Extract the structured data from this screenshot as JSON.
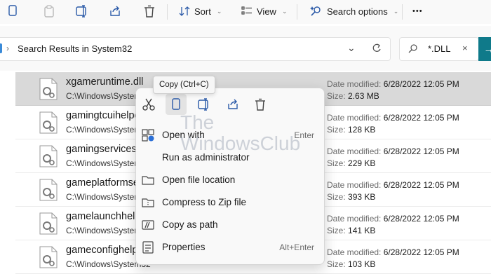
{
  "toolbar": {
    "sort_label": "Sort",
    "view_label": "View",
    "search_options_label": "Search options",
    "more_label": "•••"
  },
  "address": {
    "path_text": "Search Results in System32"
  },
  "search": {
    "value": "*.DLL"
  },
  "files": [
    {
      "name": "xgameruntime.dll",
      "path": "C:\\Windows\\System32",
      "date_label": "Date modified:",
      "date": "6/28/2022 12:05 PM",
      "size_label": "Size:",
      "size": "2.63 MB"
    },
    {
      "name": "gamingtcuihelpers.dll",
      "path": "C:\\Windows\\System32",
      "date_label": "Date modified:",
      "date": "6/28/2022 12:05 PM",
      "size_label": "Size:",
      "size": "128 KB"
    },
    {
      "name": "gamingservicesproxy.dll",
      "path": "C:\\Windows\\System32",
      "date_label": "Date modified:",
      "date": "6/28/2022 12:05 PM",
      "size_label": "Size:",
      "size": "229 KB"
    },
    {
      "name": "gameplatformservices.dll",
      "path": "C:\\Windows\\System32",
      "date_label": "Date modified:",
      "date": "6/28/2022 12:05 PM",
      "size_label": "Size:",
      "size": "393 KB"
    },
    {
      "name": "gamelaunchhelper.dll",
      "path": "C:\\Windows\\System32",
      "date_label": "Date modified:",
      "date": "6/28/2022 12:05 PM",
      "size_label": "Size:",
      "size": "141 KB"
    },
    {
      "name": "gameconfighelper.dll",
      "path": "C:\\Windows\\System32",
      "date_label": "Date modified:",
      "date": "6/28/2022 12:05 PM",
      "size_label": "Size:",
      "size": "103 KB"
    }
  ],
  "tooltip": {
    "text": "Copy (Ctrl+C)"
  },
  "context_menu": {
    "items": [
      {
        "label": "Open with",
        "shortcut": "Enter"
      },
      {
        "label": "Run as administrator",
        "shortcut": ""
      },
      {
        "label": "Open file location",
        "shortcut": ""
      },
      {
        "label": "Compress to Zip file",
        "shortcut": ""
      },
      {
        "label": "Copy as path",
        "shortcut": ""
      },
      {
        "label": "Properties",
        "shortcut": "Alt+Enter"
      }
    ]
  },
  "watermark": {
    "line1": "The",
    "line2": "WindowsClub"
  },
  "colors": {
    "accent": "#0f7a8a",
    "selected_row": "#d9d9d9",
    "menu_bg": "#f9f9f9"
  }
}
